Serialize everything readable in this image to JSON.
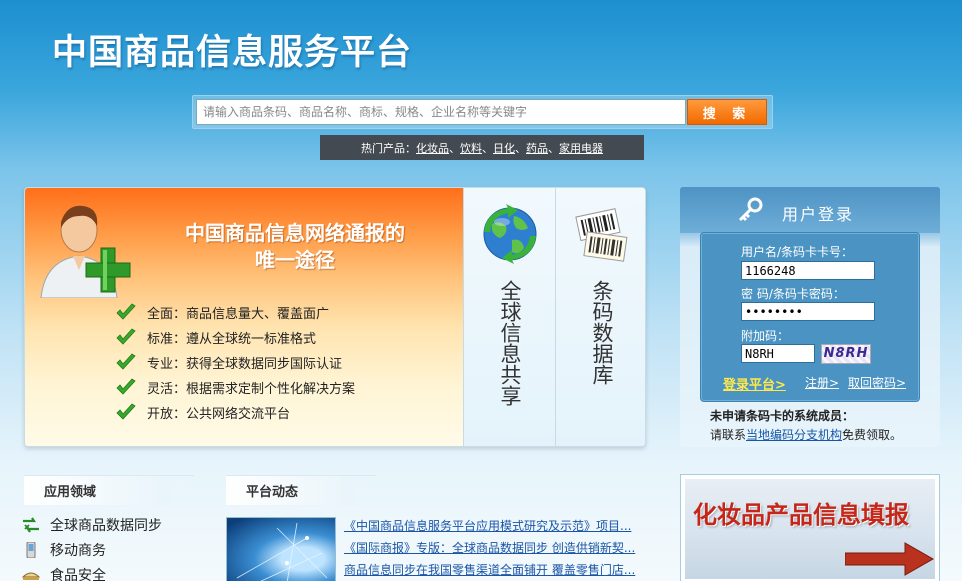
{
  "header": {
    "site_title": "中国商品信息服务平台",
    "search_placeholder": "请输入商品条码、商品名称、商标、规格、企业名称等关键字",
    "search_button": "搜 索",
    "hot_label": "热门产品：",
    "hot_items": [
      "化妆品",
      "饮料",
      "日化",
      "药品",
      "家用电器"
    ]
  },
  "feature": {
    "headline_line1": "中国商品信息网络通报的",
    "headline_line2": "唯一途径",
    "points": [
      "全面：商品信息量大、覆盖面广",
      "标准：遵从全球统一标准格式",
      "专业：获得全球数据同步国际认证",
      "灵活：根据需求定制个性化解决方案",
      "开放：公共网络交流平台"
    ],
    "col1_label": "全球信息共享",
    "col2_label": "条码数据库"
  },
  "login": {
    "title": "用户登录",
    "username_label": "用户名/条码卡卡号：",
    "username_value": "1166248",
    "password_label": "密 码/条码卡密码：",
    "password_value": "12345678",
    "captcha_label": "附加码：",
    "captcha_value": "N8RH",
    "captcha_image_text": "N8RH",
    "login_link": "登录平台>",
    "register_link": "注册>",
    "recover_link": "取回密码>",
    "footer_title": "未申请条码卡的系统成员：",
    "footer_prefix": "请联系",
    "footer_link": "当地编码分支机构",
    "footer_suffix": "免费领取。"
  },
  "apps": {
    "heading": "应用领域",
    "items": [
      "全球商品数据同步",
      "移动商务",
      "食品安全"
    ]
  },
  "news": {
    "heading": "平台动态",
    "items": [
      "《中国商品信息服务平台应用模式研究及示范》项目...",
      "《国际商报》专版：全球商品数据同步 创造供销新契...",
      "商品信息同步在我国零售渠道全面铺开 覆盖零售门店..."
    ]
  },
  "banner": {
    "text": "化妆品产品信息填报"
  },
  "colors": {
    "accent_orange": "#f26a00",
    "link_blue": "#1a55a6",
    "login_blue": "#4a93c2"
  }
}
